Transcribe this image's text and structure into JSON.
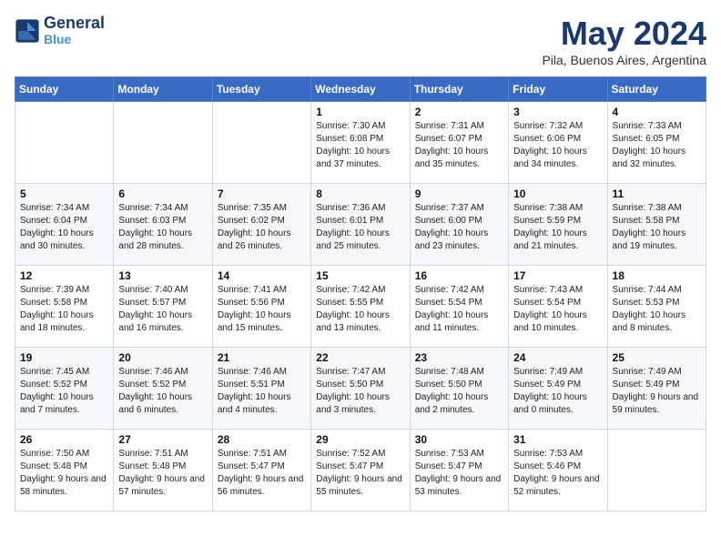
{
  "header": {
    "logo_line1": "General",
    "logo_line2": "Blue",
    "month_title": "May 2024",
    "location": "Pila, Buenos Aires, Argentina"
  },
  "weekdays": [
    "Sunday",
    "Monday",
    "Tuesday",
    "Wednesday",
    "Thursday",
    "Friday",
    "Saturday"
  ],
  "weeks": [
    [
      null,
      null,
      null,
      {
        "day": "1",
        "sunrise": "7:30 AM",
        "sunset": "6:08 PM",
        "daylight": "10 hours and 37 minutes."
      },
      {
        "day": "2",
        "sunrise": "7:31 AM",
        "sunset": "6:07 PM",
        "daylight": "10 hours and 35 minutes."
      },
      {
        "day": "3",
        "sunrise": "7:32 AM",
        "sunset": "6:06 PM",
        "daylight": "10 hours and 34 minutes."
      },
      {
        "day": "4",
        "sunrise": "7:33 AM",
        "sunset": "6:05 PM",
        "daylight": "10 hours and 32 minutes."
      }
    ],
    [
      {
        "day": "5",
        "sunrise": "7:34 AM",
        "sunset": "6:04 PM",
        "daylight": "10 hours and 30 minutes."
      },
      {
        "day": "6",
        "sunrise": "7:34 AM",
        "sunset": "6:03 PM",
        "daylight": "10 hours and 28 minutes."
      },
      {
        "day": "7",
        "sunrise": "7:35 AM",
        "sunset": "6:02 PM",
        "daylight": "10 hours and 26 minutes."
      },
      {
        "day": "8",
        "sunrise": "7:36 AM",
        "sunset": "6:01 PM",
        "daylight": "10 hours and 25 minutes."
      },
      {
        "day": "9",
        "sunrise": "7:37 AM",
        "sunset": "6:00 PM",
        "daylight": "10 hours and 23 minutes."
      },
      {
        "day": "10",
        "sunrise": "7:38 AM",
        "sunset": "5:59 PM",
        "daylight": "10 hours and 21 minutes."
      },
      {
        "day": "11",
        "sunrise": "7:38 AM",
        "sunset": "5:58 PM",
        "daylight": "10 hours and 19 minutes."
      }
    ],
    [
      {
        "day": "12",
        "sunrise": "7:39 AM",
        "sunset": "5:58 PM",
        "daylight": "10 hours and 18 minutes."
      },
      {
        "day": "13",
        "sunrise": "7:40 AM",
        "sunset": "5:57 PM",
        "daylight": "10 hours and 16 minutes."
      },
      {
        "day": "14",
        "sunrise": "7:41 AM",
        "sunset": "5:56 PM",
        "daylight": "10 hours and 15 minutes."
      },
      {
        "day": "15",
        "sunrise": "7:42 AM",
        "sunset": "5:55 PM",
        "daylight": "10 hours and 13 minutes."
      },
      {
        "day": "16",
        "sunrise": "7:42 AM",
        "sunset": "5:54 PM",
        "daylight": "10 hours and 11 minutes."
      },
      {
        "day": "17",
        "sunrise": "7:43 AM",
        "sunset": "5:54 PM",
        "daylight": "10 hours and 10 minutes."
      },
      {
        "day": "18",
        "sunrise": "7:44 AM",
        "sunset": "5:53 PM",
        "daylight": "10 hours and 8 minutes."
      }
    ],
    [
      {
        "day": "19",
        "sunrise": "7:45 AM",
        "sunset": "5:52 PM",
        "daylight": "10 hours and 7 minutes."
      },
      {
        "day": "20",
        "sunrise": "7:46 AM",
        "sunset": "5:52 PM",
        "daylight": "10 hours and 6 minutes."
      },
      {
        "day": "21",
        "sunrise": "7:46 AM",
        "sunset": "5:51 PM",
        "daylight": "10 hours and 4 minutes."
      },
      {
        "day": "22",
        "sunrise": "7:47 AM",
        "sunset": "5:50 PM",
        "daylight": "10 hours and 3 minutes."
      },
      {
        "day": "23",
        "sunrise": "7:48 AM",
        "sunset": "5:50 PM",
        "daylight": "10 hours and 2 minutes."
      },
      {
        "day": "24",
        "sunrise": "7:49 AM",
        "sunset": "5:49 PM",
        "daylight": "10 hours and 0 minutes."
      },
      {
        "day": "25",
        "sunrise": "7:49 AM",
        "sunset": "5:49 PM",
        "daylight": "9 hours and 59 minutes."
      }
    ],
    [
      {
        "day": "26",
        "sunrise": "7:50 AM",
        "sunset": "5:48 PM",
        "daylight": "9 hours and 58 minutes."
      },
      {
        "day": "27",
        "sunrise": "7:51 AM",
        "sunset": "5:48 PM",
        "daylight": "9 hours and 57 minutes."
      },
      {
        "day": "28",
        "sunrise": "7:51 AM",
        "sunset": "5:47 PM",
        "daylight": "9 hours and 56 minutes."
      },
      {
        "day": "29",
        "sunrise": "7:52 AM",
        "sunset": "5:47 PM",
        "daylight": "9 hours and 55 minutes."
      },
      {
        "day": "30",
        "sunrise": "7:53 AM",
        "sunset": "5:47 PM",
        "daylight": "9 hours and 53 minutes."
      },
      {
        "day": "31",
        "sunrise": "7:53 AM",
        "sunset": "5:46 PM",
        "daylight": "9 hours and 52 minutes."
      },
      null
    ]
  ]
}
